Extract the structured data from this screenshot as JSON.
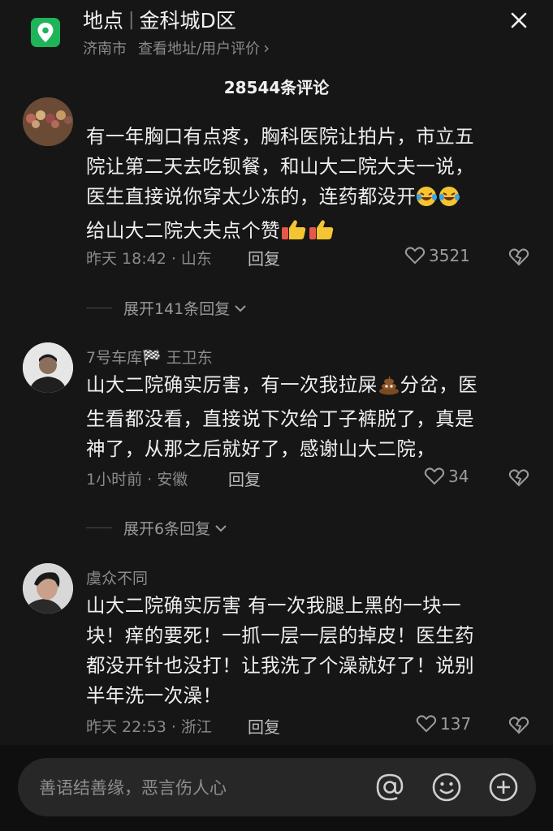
{
  "header": {
    "place_label": "地点",
    "place_name": "金科城D区",
    "city": "济南市",
    "info_link": "查看地址/用户评价",
    "chevron": "›"
  },
  "comment_count": "28544条评论",
  "comments": [
    {
      "text_lines": [
        "有一年胸口有点疼，胸科医院让拍片，市立五",
        "院让第二天去吃钡餐，和山大二院大夫一说，",
        "医生直接说你穿太少冻的，连药都没开",
        "给山大二院大夫点个赞"
      ],
      "time_location": "昨天 18:42 · 山东",
      "reply_label": "回复",
      "likes": "3521",
      "expand_text": "展开141条回复"
    },
    {
      "username": "7号车库🏁 王卫东",
      "text_lines": [
        "山大二院确实厉害，有一次我拉屎",
        "分岔，医",
        "生看都没看，直接说下次给丁子裤脱了，真是",
        "神了，从那之后就好了，感谢山大二院，"
      ],
      "time_location": "1小时前 · 安徽",
      "reply_label": "回复",
      "likes": "34",
      "expand_text": "展开6条回复"
    },
    {
      "username": "虞众不同",
      "text_lines": [
        "山大二院确实厉害 有一次我腿上黑的一块一",
        "块！痒的要死！一抓一层一层的掉皮！医生药",
        "都没开针也没打！让我洗了个澡就好了！说别",
        "半年洗一次澡！"
      ],
      "time_location": "昨天 22:53 · 浙江",
      "reply_label": "回复",
      "likes": "137"
    }
  ],
  "input": {
    "placeholder": "善语结善缘，恶言伤人心"
  },
  "colors": {
    "background": "#161616",
    "location_icon": "#1fb35a",
    "bottom_bar": "#0f0f0f"
  },
  "icons": [
    "location-pin-icon",
    "close-icon",
    "heart-icon",
    "dislike-icon",
    "chevron-down-icon",
    "at-icon",
    "emoji-icon",
    "plus-icon"
  ]
}
